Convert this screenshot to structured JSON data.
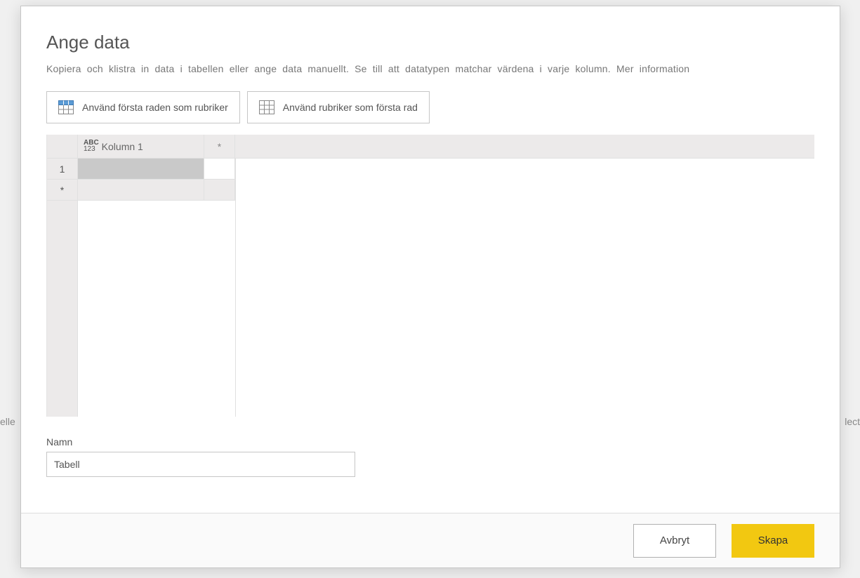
{
  "bg": {
    "left": "elle",
    "right": "lect"
  },
  "dialog": {
    "title": "Ange data",
    "subtitle_main": "Kopiera och klistra in data i tabellen eller ange data manuellt. Se till att datatypen matchar värdena i varje kolumn.",
    "more_info": "Mer information"
  },
  "toolbar": {
    "headers_button": "Använd första raden som rubriker",
    "unheader_button": "Använd rubriker som första rad"
  },
  "grid": {
    "type_abc": "ABC",
    "type_123": "123",
    "column1_name": "Kolumn 1",
    "add_col": "*",
    "row1_num": "1",
    "add_row": "*"
  },
  "name": {
    "label": "Namn",
    "value": "Tabell"
  },
  "footer": {
    "cancel": "Avbryt",
    "create": "Skapa"
  }
}
